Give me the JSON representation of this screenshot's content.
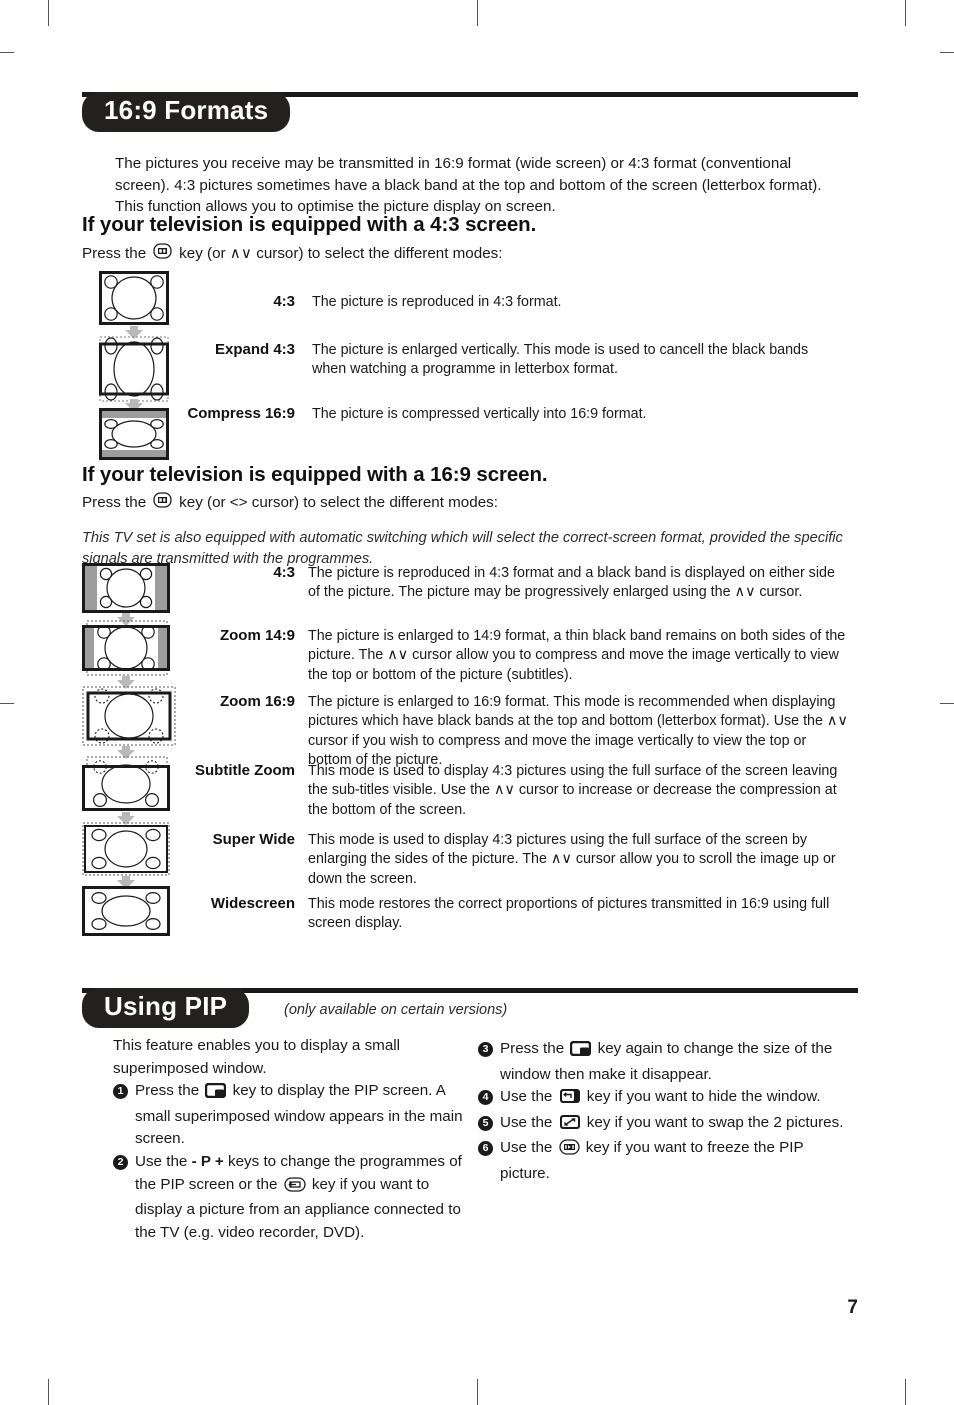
{
  "page": {
    "number": "7"
  },
  "sections": [
    {
      "title": "16:9 Formats",
      "note": "",
      "intro": "The pictures you receive may be transmitted in 16:9 format (wide screen) or 4:3 format (conventional screen). 4:3 pictures sometimes have a black band at the top and bottom of the screen (letterbox format). This function allows you to optimise the picture display on screen."
    },
    {
      "title": "Using PIP",
      "note": "(only available on certain versions)"
    }
  ],
  "subsection_43": {
    "heading": "If your television is equipped with a 4:3 screen.",
    "press_prefix": "Press the",
    "press_icon": "format-key-icon",
    "press_suffix": "key (or ∧∨ cursor) to select the different modes:",
    "formats": [
      {
        "label": "4:3",
        "description": "The picture is reproduced in 4:3 format.",
        "glyph": "tv-4by3"
      },
      {
        "label": "Expand 4:3",
        "description": "The picture is enlarged vertically. This mode is used to cancell the black bands when watching a programme in letterbox format.",
        "glyph": "tv-expand-4by3"
      },
      {
        "label": "Compress 16:9",
        "description": "The picture is compressed vertically into 16:9 format.",
        "glyph": "tv-compress-16by9"
      }
    ]
  },
  "subsection_169": {
    "heading": "If your television is equipped with a 16:9 screen.",
    "press_prefix": "Press the",
    "press_icon": "format-key-icon",
    "press_suffix": "key (or <> cursor) to select the different modes:",
    "italic_note": "This TV set is also equipped with automatic switching which will select the correct-screen format, provided the specific signals are transmitted with the programmes.",
    "formats": [
      {
        "label": "4:3",
        "description": "The picture is reproduced in 4:3 format and a black band is displayed on either side of the picture. The picture may be progressively enlarged using the ∧∨ cursor.",
        "glyph": "tv-wide-4by3"
      },
      {
        "label": "Zoom 14:9",
        "description": "The picture is enlarged to 14:9 format, a thin black band remains on both sides of the picture. The ∧∨ cursor allow you to compress and move the image vertically to view the top or bottom of the picture (subtitles).",
        "glyph": "tv-zoom-14by9"
      },
      {
        "label": "Zoom 16:9",
        "description": "The picture is enlarged to 16:9 format. This mode is recommended when displaying pictures which have black bands at the top and bottom (letterbox format). Use the ∧∨ cursor if you wish to compress and move the image vertically to view the top or bottom of the picture.",
        "glyph": "tv-zoom-16by9"
      },
      {
        "label": "Subtitle Zoom",
        "description": "This mode is used to display 4:3 pictures using the full surface of the screen leaving the sub-titles visible. Use the ∧∨ cursor to increase or decrease the compression at the bottom of the screen.",
        "glyph": "tv-subtitle-zoom"
      },
      {
        "label": "Super Wide",
        "description": "This mode is used to display 4:3 pictures using the full surface of the screen by enlarging the sides of the picture. The ∧∨ cursor allow you to scroll the image up or down the screen.",
        "glyph": "tv-super-wide"
      },
      {
        "label": "Widescreen",
        "description": "This mode restores the correct proportions of pictures transmitted in 16:9 using full screen display.",
        "glyph": "tv-widescreen"
      }
    ]
  },
  "pip": {
    "intro": "This feature enables you to display a small superimposed window.",
    "left_items": [
      {
        "number": "❶",
        "number_value": "1",
        "parts": [
          {
            "type": "text",
            "value": "Press the "
          },
          {
            "type": "icon",
            "value": "pip-key-icon"
          },
          {
            "type": "text",
            "value": " key to display the PIP screen. A small superimposed window appears in the main screen."
          }
        ]
      },
      {
        "number": "❷",
        "number_value": "2",
        "parts": [
          {
            "type": "text",
            "value": "Use the "
          },
          {
            "type": "bold",
            "value": "- P +"
          },
          {
            "type": "text",
            "value": " keys to change the programmes of the PIP screen or the "
          },
          {
            "type": "icon",
            "value": "av-source-key-icon"
          },
          {
            "type": "text",
            "value": " key if you want to display a picture from an appliance connected to the TV (e.g. video recorder, DVD)."
          }
        ]
      }
    ],
    "right_items": [
      {
        "number": "❸",
        "number_value": "3",
        "parts": [
          {
            "type": "text",
            "value": "Press the "
          },
          {
            "type": "icon",
            "value": "pip-key-icon"
          },
          {
            "type": "text",
            "value": " key again to change the size of the window then make it disappear."
          }
        ]
      },
      {
        "number": "❹",
        "number_value": "4",
        "parts": [
          {
            "type": "text",
            "value": "Use the "
          },
          {
            "type": "icon",
            "value": "hide-window-key-icon"
          },
          {
            "type": "text",
            "value": " key if you want to hide the window."
          }
        ]
      },
      {
        "number": "❺",
        "number_value": "5",
        "parts": [
          {
            "type": "text",
            "value": "Use the "
          },
          {
            "type": "icon",
            "value": "swap-pictures-key-icon"
          },
          {
            "type": "text",
            "value": " key if you want to swap the 2 pictures."
          }
        ]
      },
      {
        "number": "❻",
        "number_value": "6",
        "parts": [
          {
            "type": "text",
            "value": "Use the "
          },
          {
            "type": "icon",
            "value": "freeze-key-icon"
          },
          {
            "type": "text",
            "value": " key if you want to freeze the PIP picture."
          }
        ]
      }
    ]
  },
  "colors": {
    "ink": "#1a1a1a",
    "pill_background": "#232020",
    "pill_text": "#ffffff",
    "band_gray": "#9d9d9d",
    "arrow_gray": "#b9b9b9"
  }
}
